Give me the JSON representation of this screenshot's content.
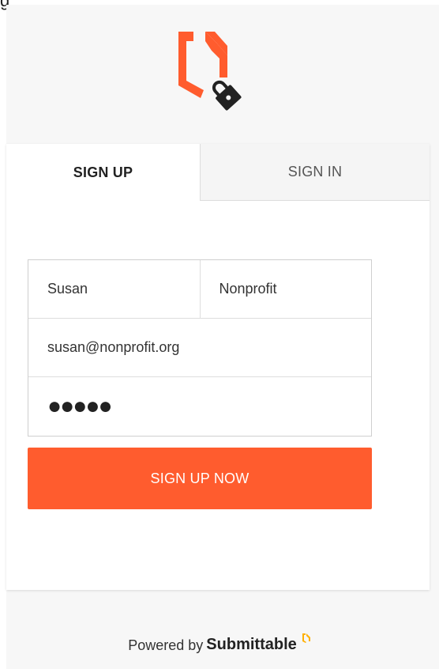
{
  "corner_glyph": "g",
  "logo": {
    "icon": "submittable-lock-logo-icon",
    "accent_color": "#ff5c2e"
  },
  "tabs": [
    {
      "label": "SIGN UP",
      "active": true
    },
    {
      "label": "SIGN IN",
      "active": false
    }
  ],
  "form": {
    "first_name": {
      "value": "Susan"
    },
    "last_name": {
      "value": "Nonprofit"
    },
    "email": {
      "value": "susan@nonprofit.org"
    },
    "password": {
      "value": "●●●●●"
    },
    "submit_label": "SIGN UP NOW"
  },
  "footer": {
    "powered_by": "Powered by",
    "brand": "Submittable",
    "brand_icon": "submittable-mark-icon"
  },
  "colors": {
    "accent": "#ff5c2e",
    "background": "#f7f7f7",
    "card": "#ffffff"
  }
}
